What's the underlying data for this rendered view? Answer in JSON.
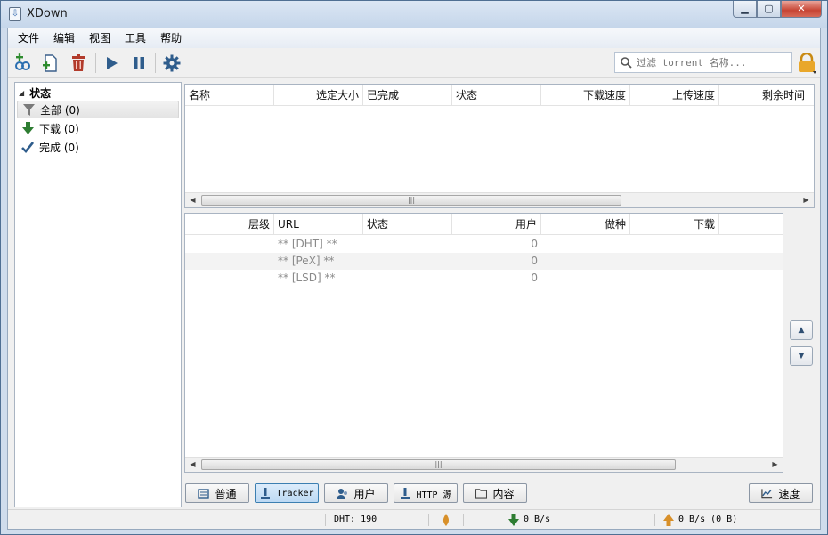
{
  "window": {
    "title": "XDown"
  },
  "menu": [
    "文件",
    "编辑",
    "视图",
    "工具",
    "帮助"
  ],
  "search": {
    "placeholder": "过滤 torrent 名称..."
  },
  "sidebar": {
    "header": "状态",
    "items": [
      {
        "label": "全部 (0)",
        "icon": "filter-icon"
      },
      {
        "label": "下载 (0)",
        "icon": "download-arrow-icon"
      },
      {
        "label": "完成 (0)",
        "icon": "checkmark-icon"
      }
    ]
  },
  "torrent_table": {
    "columns": [
      "名称",
      "选定大小",
      "已完成",
      "状态",
      "下载速度",
      "上传速度",
      "剩余时间"
    ]
  },
  "tracker_table": {
    "columns": [
      "层级",
      "URL",
      "状态",
      "用户",
      "做种",
      "下载"
    ],
    "rows": [
      {
        "url": "** [DHT] **",
        "users": "0"
      },
      {
        "url": "** [PeX] **",
        "users": "0"
      },
      {
        "url": "** [LSD] **",
        "users": "0"
      }
    ]
  },
  "tabs": {
    "general": "普通",
    "tracker": "Tracker",
    "peers": "用户",
    "http_sources": "HTTP 源",
    "content": "内容",
    "speed": "速度"
  },
  "status": {
    "dht": "DHT: 190",
    "download_speed": "0 B/s",
    "upload_speed": "0 B/s (0 B)"
  },
  "colors": {
    "accent": "#2a6eb0",
    "download_arrow": "#2e7d32",
    "delete_red": "#b23b2b"
  }
}
